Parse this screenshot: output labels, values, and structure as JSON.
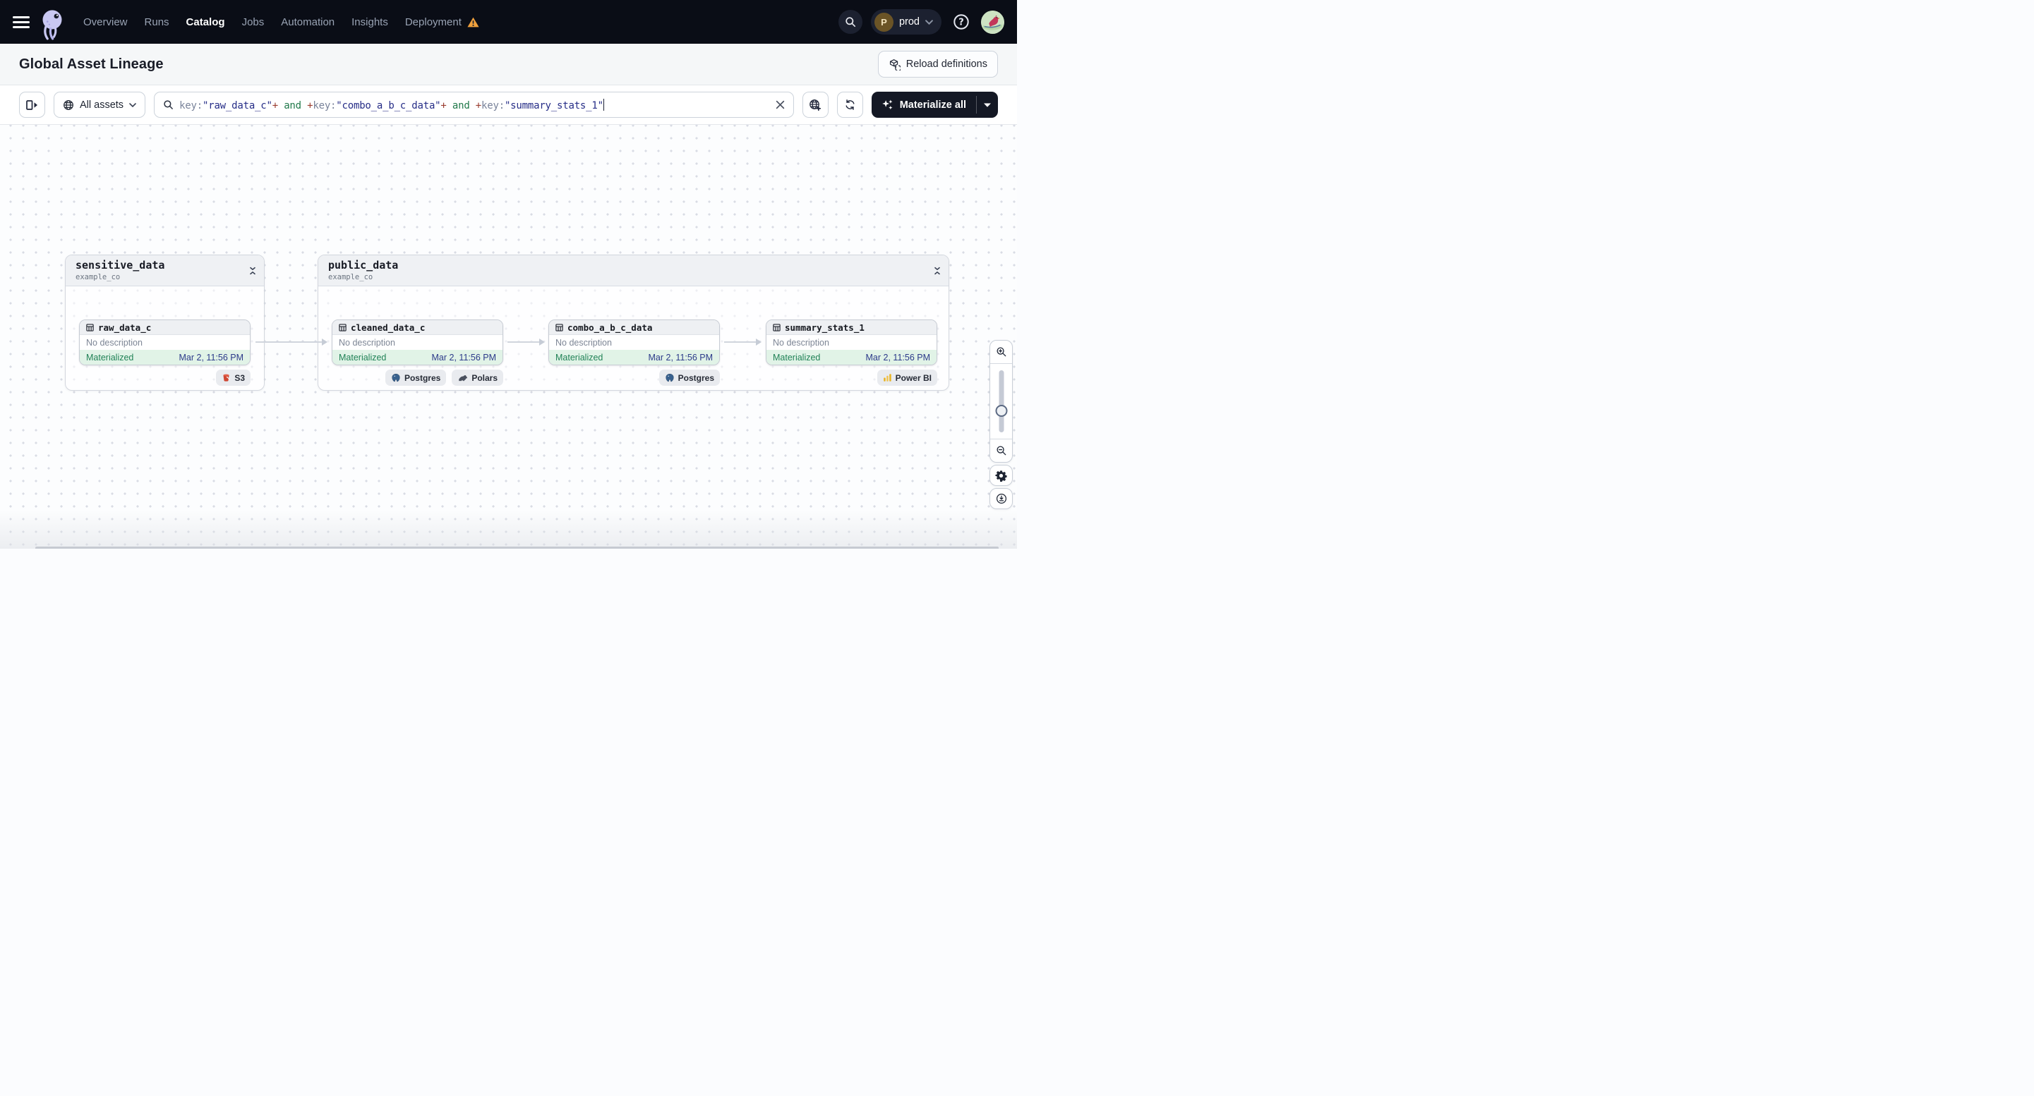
{
  "nav": {
    "items": [
      {
        "label": "Overview"
      },
      {
        "label": "Runs"
      },
      {
        "label": "Catalog",
        "active": true
      },
      {
        "label": "Jobs"
      },
      {
        "label": "Automation"
      },
      {
        "label": "Insights"
      },
      {
        "label": "Deployment",
        "warning": true
      }
    ],
    "environment": {
      "initial": "P",
      "name": "prod"
    }
  },
  "header": {
    "title": "Global Asset Lineage",
    "reload_label": "Reload definitions"
  },
  "toolbar": {
    "scope_label": "All assets",
    "materialize_label": "Materialize all",
    "query_segments": [
      {
        "text": "key:",
        "color": "#79839a"
      },
      {
        "text": "\"raw_data_c\"",
        "color": "#262d87"
      },
      {
        "text": "+",
        "color": "#9a3b2e"
      },
      {
        "text": " and ",
        "color": "#20794a"
      },
      {
        "text": "+",
        "color": "#9a3b2e"
      },
      {
        "text": "key:",
        "color": "#79839a"
      },
      {
        "text": "\"combo_a_b_c_data\"",
        "color": "#262d87"
      },
      {
        "text": "+",
        "color": "#9a3b2e"
      },
      {
        "text": " and ",
        "color": "#20794a"
      },
      {
        "text": "+",
        "color": "#9a3b2e"
      },
      {
        "text": "key:",
        "color": "#79839a"
      },
      {
        "text": "\"summary_stats_1\"",
        "color": "#262d87"
      }
    ]
  },
  "graph": {
    "groups": [
      {
        "name": "sensitive_data",
        "repo": "example_co",
        "nodes": [
          {
            "name": "raw_data_c",
            "description": "No description",
            "status": "Materialized",
            "timestamp": "Mar 2, 11:56 PM",
            "badges": [
              {
                "label": "S3",
                "icon": "s3-bucket-icon"
              }
            ]
          }
        ]
      },
      {
        "name": "public_data",
        "repo": "example_co",
        "nodes": [
          {
            "name": "cleaned_data_c",
            "description": "No description",
            "status": "Materialized",
            "timestamp": "Mar 2, 11:56 PM",
            "badges": [
              {
                "label": "Postgres",
                "icon": "postgres-icon"
              },
              {
                "label": "Polars",
                "icon": "polars-icon"
              }
            ]
          },
          {
            "name": "combo_a_b_c_data",
            "description": "No description",
            "status": "Materialized",
            "timestamp": "Mar 2, 11:56 PM",
            "badges": [
              {
                "label": "Postgres",
                "icon": "postgres-icon"
              }
            ]
          },
          {
            "name": "summary_stats_1",
            "description": "No description",
            "status": "Materialized",
            "timestamp": "Mar 2, 11:56 PM",
            "badges": [
              {
                "label": "Power BI",
                "icon": "powerbi-icon"
              }
            ]
          }
        ]
      }
    ]
  },
  "colors": {
    "nav_background": "#0a0d16",
    "accent_dark_button": "#141824",
    "status_materialized_bg": "#e1f3e7",
    "status_materialized_text": "#208256",
    "timestamp_text": "#2c3a8a",
    "warning_orange": "#f0a03c"
  }
}
